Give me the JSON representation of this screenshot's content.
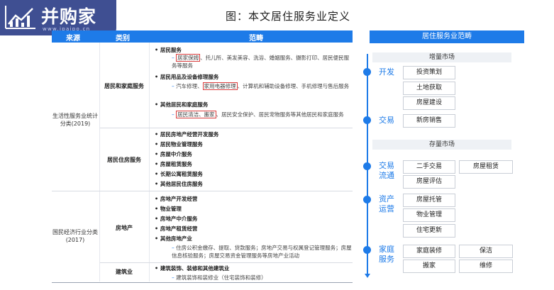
{
  "logo": {
    "name": "并购家",
    "url": "www.ipaipo.cn"
  },
  "title": "图：本文居住服务业定义",
  "table": {
    "headers": [
      "来源",
      "类别",
      "范畴"
    ],
    "sources": [
      "生活性服务业统计分类(2019)",
      "国民经济行业分类(2017)"
    ],
    "groups": {
      "home_service": {
        "category": "居民和家庭服务",
        "resident_services": {
          "title": "居民服务",
          "hl": "居家保姆",
          "rest": "、托儿所、美发美容、洗浴、婚姻服务、摄影打印、居民便民服务等服务"
        },
        "goods_repair": {
          "title": "居民用品及设备修理服务",
          "pre": "汽车修理、",
          "hl": "家用电器修理",
          "rest": "、计算机和辅助设备修理、手机修理与售后服务"
        },
        "other": {
          "title": "其他居民和家庭服务",
          "hl": "居民清洁、搬家",
          "rest": "、居民安全保护、居民宠物服务等其他居民和家庭服务"
        }
      },
      "housing_service": {
        "category": "居民住房服务",
        "items": [
          "居民房地产经营开发服务",
          "居民物业管理服务",
          "房屋中介服务",
          "房屋租赁服务",
          "长期公寓租赁服务",
          "其他居民住房服务"
        ]
      },
      "real_estate": {
        "category": "房地产",
        "items": [
          "房地产开发经营",
          "物业管理",
          "房地产中介服务",
          "房地产租赁经营",
          "其他房地产业"
        ],
        "detail": "住房公积金缴存、提取、贷款服务；房地产交易与权属登记管理服务；房屋信息核验服务；房屋交易资金管理服务等房地产业活动"
      },
      "construction": {
        "category": "建筑业",
        "item": "建筑装饰、装修和其他建筑业",
        "detail": "建筑装饰和装修业（住宅装饰和装修）"
      }
    }
  },
  "panel": {
    "title": "居住服务业范畴",
    "incremental": "增量市场",
    "stock": "存量市场",
    "develop": {
      "label": "开发",
      "items": [
        "投资策划",
        "土地获取",
        "房屋建设"
      ]
    },
    "trade": {
      "label": "交易",
      "items": [
        "新房销售"
      ]
    },
    "circulation": {
      "label1": "交易",
      "label2": "流通",
      "items": [
        "二手交易",
        "房屋租赁",
        "房屋评估"
      ]
    },
    "asset": {
      "label1": "资产",
      "label2": "运营",
      "items": [
        "房屋托管",
        "物业管理",
        "住宅更新"
      ]
    },
    "family": {
      "label1": "家庭",
      "label2": "服务",
      "items": [
        "家庭装修",
        "保洁",
        "搬家",
        "维修"
      ]
    }
  },
  "colors": {
    "accent": "#1e7be8",
    "highlight": "#d93b3b",
    "logo_bg": "#3f4f92"
  }
}
